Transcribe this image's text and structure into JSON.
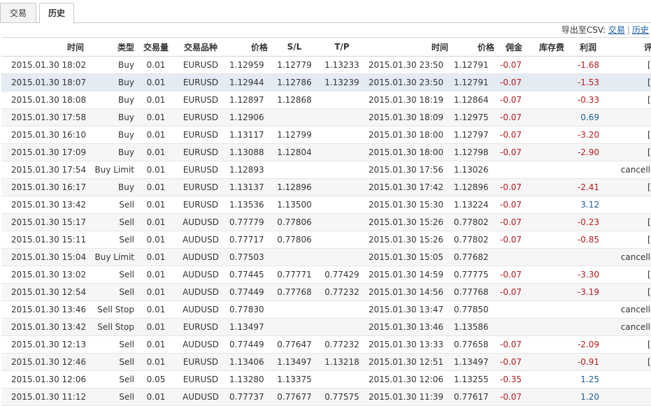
{
  "tabs": [
    "交易",
    "历史"
  ],
  "export": {
    "prefix": "导出至CSV:",
    "link1": "交易",
    "sep": "|",
    "link2": "历史"
  },
  "columns": [
    "时间",
    "类型",
    "交易量",
    "交易品种",
    "价格",
    "S/L",
    "T/P",
    "时间",
    "价格",
    "佣金",
    "库存费",
    "利润",
    "评论"
  ],
  "colors": {
    "negative": "#b21b1b",
    "positive": "#1d5e94",
    "selected_row": "#e4ebf3"
  },
  "rows": [
    [
      "2015.01.30 18:02",
      "Buy",
      "0.01",
      "EURUSD",
      "1.12959",
      "1.12779",
      "1.13233",
      "2015.01.30 23:50",
      "1.12791",
      "-0.07",
      "",
      "-1.68",
      "[sl]"
    ],
    [
      "2015.01.30 18:07",
      "Buy",
      "0.01",
      "EURUSD",
      "1.12944",
      "1.12786",
      "1.13239",
      "2015.01.30 23:50",
      "1.12791",
      "-0.07",
      "",
      "-1.53",
      "[sl]"
    ],
    [
      "2015.01.30 18:08",
      "Buy",
      "0.01",
      "EURUSD",
      "1.12897",
      "1.12868",
      "",
      "2015.01.30 18:19",
      "1.12864",
      "-0.07",
      "",
      "-0.33",
      "[sl]"
    ],
    [
      "2015.01.30 17:58",
      "Buy",
      "0.01",
      "EURUSD",
      "1.12906",
      "",
      "",
      "2015.01.30 18:09",
      "1.12975",
      "-0.07",
      "",
      "0.69",
      ""
    ],
    [
      "2015.01.30 16:10",
      "Buy",
      "0.01",
      "EURUSD",
      "1.13117",
      "1.12799",
      "",
      "2015.01.30 18:00",
      "1.12797",
      "-0.07",
      "",
      "-3.20",
      "[sl]"
    ],
    [
      "2015.01.30 17:09",
      "Buy",
      "0.01",
      "EURUSD",
      "1.13088",
      "1.12804",
      "",
      "2015.01.30 18:00",
      "1.12798",
      "-0.07",
      "",
      "-2.90",
      "[sl]"
    ],
    [
      "2015.01.30 17:54",
      "Buy Limit",
      "0.01",
      "EURUSD",
      "1.12893",
      "",
      "",
      "2015.01.30 17:56",
      "1.13026",
      "",
      "",
      "",
      "cancelled"
    ],
    [
      "2015.01.30 16:17",
      "Buy",
      "0.01",
      "EURUSD",
      "1.13137",
      "1.12896",
      "",
      "2015.01.30 17:42",
      "1.12896",
      "-0.07",
      "",
      "-2.41",
      "[sl]"
    ],
    [
      "2015.01.30 13:42",
      "Sell",
      "0.01",
      "EURUSD",
      "1.13536",
      "1.13500",
      "",
      "2015.01.30 15:30",
      "1.13224",
      "-0.07",
      "",
      "3.12",
      ""
    ],
    [
      "2015.01.30 15:17",
      "Sell",
      "0.01",
      "AUDUSD",
      "0.77779",
      "0.77806",
      "",
      "2015.01.30 15:26",
      "0.77802",
      "-0.07",
      "",
      "-0.23",
      "[sl]"
    ],
    [
      "2015.01.30 15:11",
      "Sell",
      "0.01",
      "AUDUSD",
      "0.77717",
      "0.77806",
      "",
      "2015.01.30 15:26",
      "0.77802",
      "-0.07",
      "",
      "-0.85",
      "[sl]"
    ],
    [
      "2015.01.30 15:04",
      "Buy Limit",
      "0.01",
      "AUDUSD",
      "0.77503",
      "",
      "",
      "2015.01.30 15:05",
      "0.77682",
      "",
      "",
      "",
      "cancelled"
    ],
    [
      "2015.01.30 13:02",
      "Sell",
      "0.01",
      "AUDUSD",
      "0.77445",
      "0.77771",
      "0.77429",
      "2015.01.30 14:59",
      "0.77775",
      "-0.07",
      "",
      "-3.30",
      "[sl]"
    ],
    [
      "2015.01.30 12:54",
      "Sell",
      "0.01",
      "AUDUSD",
      "0.77449",
      "0.77768",
      "0.77232",
      "2015.01.30 14:56",
      "0.77768",
      "-0.07",
      "",
      "-3.19",
      "[sl]"
    ],
    [
      "2015.01.30 13:46",
      "Sell Stop",
      "0.01",
      "AUDUSD",
      "0.77830",
      "",
      "",
      "2015.01.30 13:47",
      "0.77850",
      "",
      "",
      "",
      "cancelled"
    ],
    [
      "2015.01.30 13:42",
      "Sell Stop",
      "0.01",
      "EURUSD",
      "1.13497",
      "",
      "",
      "2015.01.30 13:46",
      "1.13586",
      "",
      "",
      "",
      "cancelled"
    ],
    [
      "2015.01.30 12:13",
      "Sell",
      "0.01",
      "AUDUSD",
      "0.77449",
      "0.77647",
      "0.77232",
      "2015.01.30 13:33",
      "0.77658",
      "-0.07",
      "",
      "-2.09",
      "[sl]"
    ],
    [
      "2015.01.30 12:46",
      "Sell",
      "0.01",
      "EURUSD",
      "1.13406",
      "1.13497",
      "1.13218",
      "2015.01.30 12:51",
      "1.13497",
      "-0.07",
      "",
      "-0.91",
      "[sl]"
    ],
    [
      "2015.01.30 12:06",
      "Sell",
      "0.05",
      "EURUSD",
      "1.13280",
      "1.13375",
      "",
      "2015.01.30 12:06",
      "1.13255",
      "-0.35",
      "",
      "1.25",
      ""
    ],
    [
      "2015.01.30 11:12",
      "Sell",
      "0.01",
      "AUDUSD",
      "0.77737",
      "0.77677",
      "0.77575",
      "2015.01.30 11:39",
      "0.77617",
      "-0.07",
      "",
      "1.20",
      ""
    ]
  ]
}
